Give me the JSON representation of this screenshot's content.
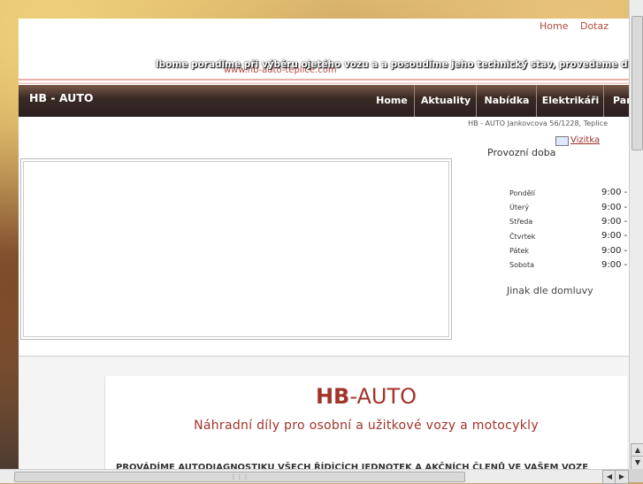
{
  "toplinks": [
    "Home",
    "Dotaz"
  ],
  "marquee": "lbome poradíme při výběru ojetého vozu a a posoudíme jeho technický stav, provedeme diagnostiku vo:",
  "weblink": "www.hb-auto-teplice.com",
  "brand": "HB - AUTO",
  "nav": [
    "Home",
    "Aktuality",
    "Nabídka",
    "Elektrikáři",
    "Par"
  ],
  "address": "HB - AUTO Jankovcova 56/1228, Teplice",
  "vizitka": "Vizitka",
  "hours": {
    "title": "Provozní doba",
    "rows": [
      {
        "day": "Pondělí",
        "time": "9:00 -"
      },
      {
        "day": "Úterý",
        "time": "9:00 -"
      },
      {
        "day": "Středa",
        "time": "9:00 -"
      },
      {
        "day": "Čtvrtek",
        "time": "9:00 -"
      },
      {
        "day": "Pátek",
        "time": "9:00 -"
      },
      {
        "day": "Sobota",
        "time": "9:00 -"
      }
    ],
    "other": "Jinak dle domluvy"
  },
  "heading": {
    "bold": "HB",
    "rest": "-AUTO"
  },
  "subtitle": "Náhradní díly pro osobní a užitkové vozy a motocykly",
  "bodytext": "PROVÁDÍME AUTODIAGNOSTIKU VŠECH ŘÍDÍCÍCH JEDNOTEK A AKČNÍCH ČLENŮ VE VAŠEM VOZE",
  "colors": {
    "accent": "#a2342a",
    "nav": "#2a2020"
  }
}
